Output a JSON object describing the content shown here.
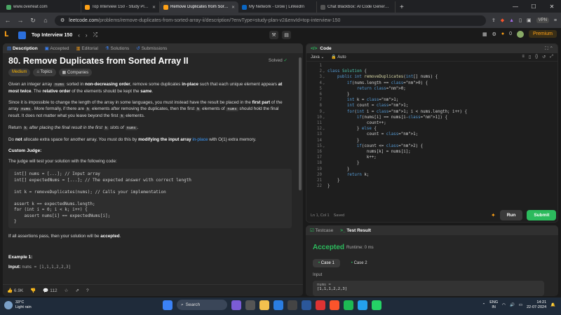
{
  "browser": {
    "tabs": [
      {
        "title": "www.overleaf.com",
        "favicon_color": "#4aa564"
      },
      {
        "title": "Top Interview 150 - Study Plan - Lee",
        "favicon_color": "#ffa116"
      },
      {
        "title": "Remove Duplicates from Sorted",
        "favicon_color": "#ffa116",
        "active": true
      },
      {
        "title": "My Network - Grow | LinkedIn",
        "favicon_color": "#0a66c2"
      },
      {
        "title": "Chat Blackbox: AI Code Generation",
        "favicon_color": "#222222"
      }
    ],
    "new_tab": "+",
    "url_host": "leetcode.com",
    "url_path": "/problems/remove-duplicates-from-sorted-array-ii/description/?envType=study-plan-v2&envId=top-interview-150",
    "vpn_label": "VPN"
  },
  "lc_nav": {
    "title": "Top Interview 150",
    "coins": "0",
    "premium": "Premium"
  },
  "left_tabs": {
    "description": "Description",
    "accepted": "Accepted",
    "editorial": "Editorial",
    "solutions": "Solutions",
    "submissions": "Submissions"
  },
  "problem": {
    "title": "80. Remove Duplicates from Sorted Array II",
    "solved": "Solved",
    "difficulty": "Medium",
    "topics": "Topics",
    "companies": "Companies",
    "custom_judge": "Custom Judge:",
    "judge_intro": "The judge will test your solution with the following code:",
    "judge_code": "int[] nums = [...]; // Input array\nint[] expectedNums = [...]; // The expected answer with correct length\n\nint k = removeDuplicates(nums); // Calls your implementation\n\nassert k == expectedNums.length;\nfor (int i = 0; i < k; i++) {\n    assert nums[i] == expectedNums[i];\n}",
    "example_heading": "Example 1:",
    "example_input_label": "Input:",
    "example_input_value": "nums = [1,1,1,2,2,3]"
  },
  "left_footer": {
    "likes": "6.9K",
    "comments": "112"
  },
  "code": {
    "header": "Code",
    "language": "Java",
    "mode": "Auto",
    "lines": [
      "",
      "class Solution {",
      "    public int removeDuplicates(int[] nums) {",
      "        if(nums.length == 0) {",
      "            return 0;",
      "        }",
      "        int k = 1;",
      "        int count = 1;",
      "        for(int i = 1; i < nums.length; i++) {",
      "            if(nums[i] == nums[i-1]) {",
      "                count++;",
      "            } else {",
      "                count = 1;",
      "            }",
      "            if(count <= 2) {",
      "                nums[k] = nums[i];",
      "                k++;",
      "            }",
      "        }",
      "        return k;",
      "    }",
      "}"
    ],
    "cursor": "Ln 1, Col 1",
    "saved": "Saved",
    "run": "Run",
    "submit": "Submit"
  },
  "result": {
    "testcase_tab": "Testcase",
    "result_tab": "Test Result",
    "status": "Accepted",
    "runtime": "Runtime: 0 ms",
    "case1": "Case 1",
    "case2": "Case 2",
    "input_label": "Input",
    "input_value": "nums =",
    "input_next": "[1,1,1,2,2,3]"
  },
  "taskbar": {
    "temp": "33°C",
    "weather": "Light rain",
    "search": "Search",
    "lang1": "ENG",
    "lang2": "IN",
    "time": "14:21",
    "date": "22-07-2024"
  }
}
